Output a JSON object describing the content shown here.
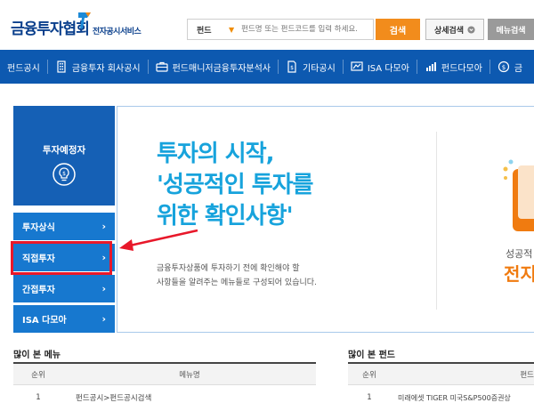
{
  "header": {
    "logo_main": "금융투자협회",
    "logo_sub": "전자공시서비스",
    "search_category": "펀드",
    "search_placeholder": "펀드명 또는 펀드코드를 입력 하세요.",
    "search_button": "검색",
    "detail_search": "상세검색",
    "menu_search": "메뉴검색"
  },
  "nav": {
    "items": [
      {
        "label": "펀드공시",
        "icon": "none"
      },
      {
        "label": "금융투자 회사공시",
        "icon": "building-icon"
      },
      {
        "label": "펀드매니저금융투자분석사",
        "icon": "briefcase-icon"
      },
      {
        "label": "기타공시",
        "icon": "document-icon"
      },
      {
        "label": "ISA 다모아",
        "icon": "isa-icon"
      },
      {
        "label": "펀드다모아",
        "icon": "bar-chart-icon"
      },
      {
        "label": "금",
        "icon": "coin-icon"
      }
    ]
  },
  "sidebar": {
    "title": "투자예정자",
    "items": [
      {
        "label": "투자상식"
      },
      {
        "label": "직접투자"
      },
      {
        "label": "간접투자"
      },
      {
        "label": "ISA 다모아"
      }
    ]
  },
  "hero": {
    "title_lines": [
      "투자의 시작,",
      "'성공적인 투자를",
      "위한 확인사항'"
    ],
    "desc_lines": [
      "금융투자상품에 투자하기 전에 확인해야 할",
      "사항들을 알려주는 메뉴들로 구성되어 있습니다."
    ],
    "right_sub": "성공적",
    "right_main": "전지"
  },
  "popular_menu": {
    "title": "많이 본 메뉴",
    "headers": [
      "순위",
      "메뉴명"
    ],
    "rows": [
      [
        "1",
        "펀드공시>펀드공시검색"
      ]
    ]
  },
  "popular_fund": {
    "title": "많이 본 펀드",
    "headers": [
      "순위",
      "펀드"
    ],
    "rows": [
      [
        "1",
        "미래에셋 TIGER 미국S&P500증권상"
      ]
    ]
  },
  "colors": {
    "nav_bg": "#0d59b0",
    "side_bg": "#1778cf",
    "accent_orange": "#f28c1c",
    "hero_blue": "#17a3dc",
    "highlight_red": "#e8182a"
  }
}
